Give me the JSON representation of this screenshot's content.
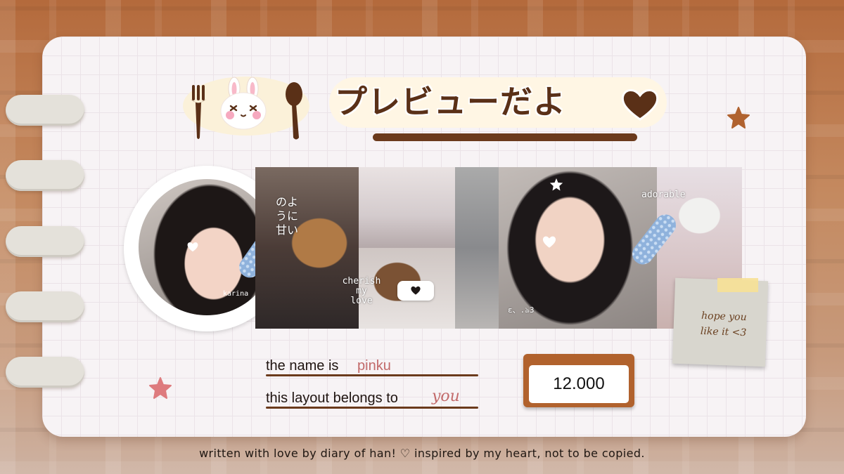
{
  "header": {
    "title": "プレビューだよ",
    "heart_icon": "heart-icon"
  },
  "profile": {
    "name_on_avatar": "karina"
  },
  "photos": {
    "text_vertical": [
      "のよ",
      "うに",
      "甘い"
    ],
    "text_cherish": [
      "cherish",
      "my",
      "love"
    ],
    "text_adorable": "adorable",
    "text_small": "ε、.ঌ3"
  },
  "note": {
    "text_line1": "hope you",
    "text_line2": "like it <3"
  },
  "fields": {
    "name_label": "the name is",
    "name_value": "pinku",
    "owner_label": "this layout belongs to",
    "owner_value": "you"
  },
  "counter": {
    "value": "12.000"
  },
  "footer": {
    "text": "written with love by diary of han! ♡ inspired by my heart, not to be copied."
  },
  "colors": {
    "brown": "#6b3a1c",
    "accent_pink": "#c26a6a",
    "counter_frame": "#b1622d",
    "notebook": "#f7f3f5"
  }
}
